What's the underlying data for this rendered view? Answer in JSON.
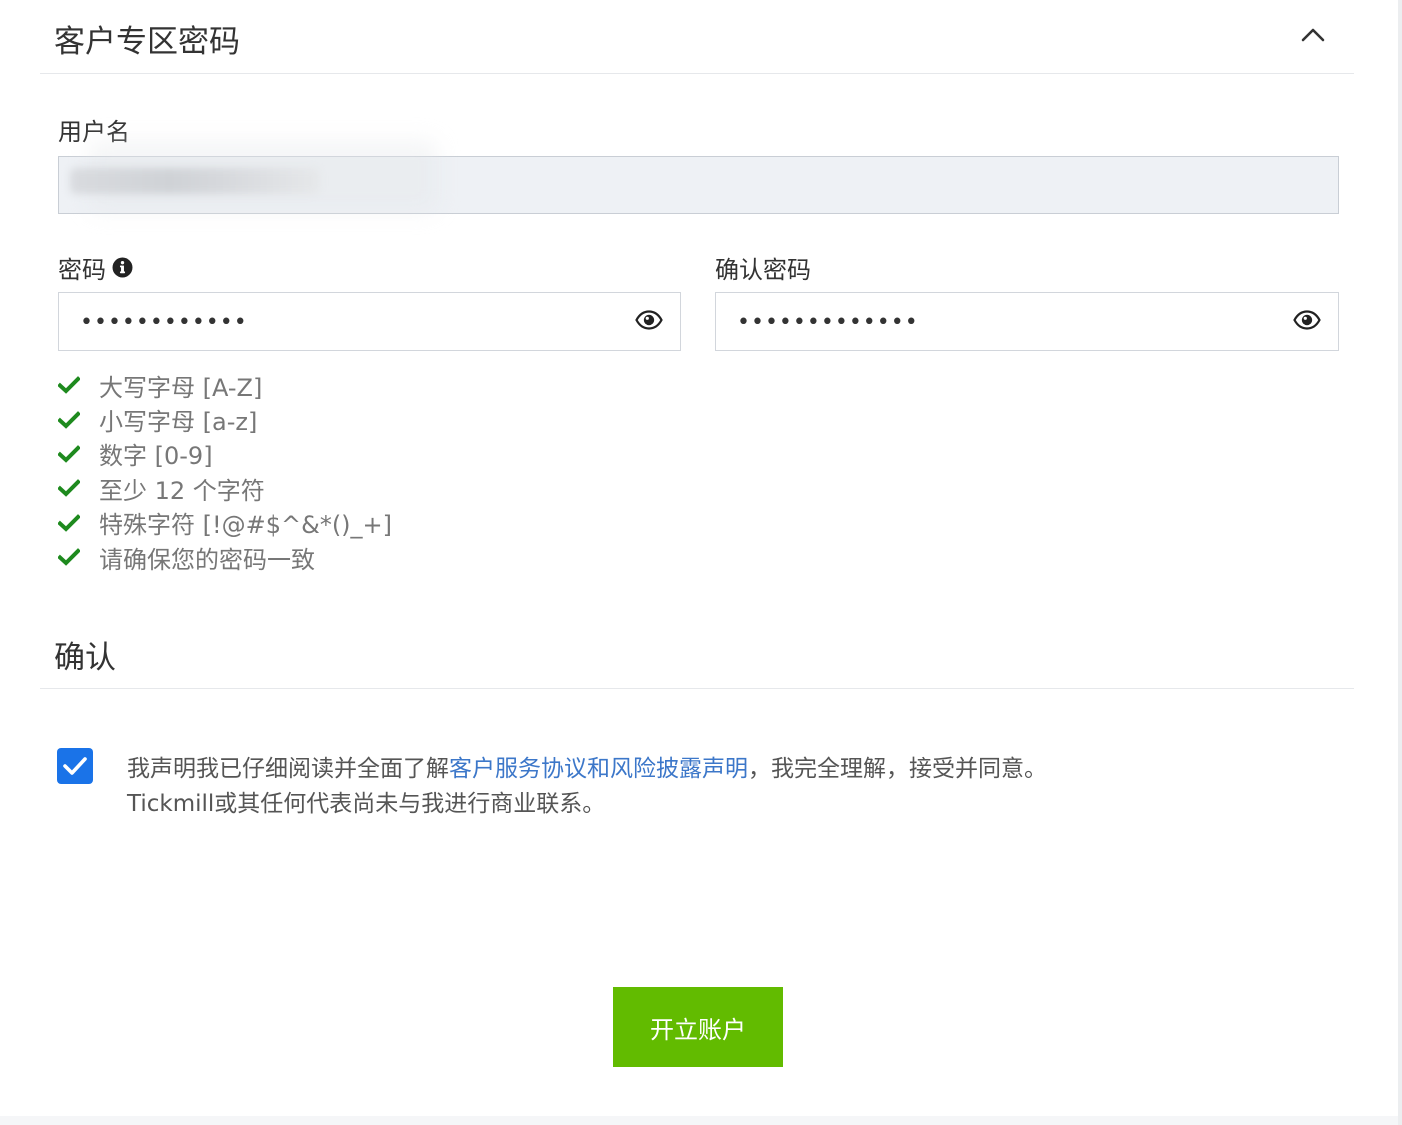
{
  "password_section": {
    "title": "客户专区密码",
    "username_label": "用户名",
    "password_label": "密码",
    "password_value": "••••••••••••",
    "confirm_label": "确认密码",
    "confirm_value": "•••••••••••••",
    "rules": [
      "大写字母 [A-Z]",
      "小写字母 [a-z]",
      "数字 [0-9]",
      "至少 12 个字符",
      "特殊字符 [!@#$^&*()_+]",
      "请确保您的密码一致"
    ],
    "rule_color": "#1e8a1e"
  },
  "confirm_section": {
    "title": "确认",
    "checked": true,
    "text_before": "我声明我已仔细阅读并全面了解",
    "link_text": "客户服务协议和风险披露声明",
    "text_after": "，我完全理解，接受并同意。",
    "text_line2": "Tickmill或其任何代表尚未与我进行商业联系。"
  },
  "submit_label": "开立账户",
  "colors": {
    "accent": "#62bb00",
    "checkbox": "#1a73e8",
    "link": "#3c77c9"
  },
  "icons": [
    "chevron-up-icon",
    "info-icon",
    "eye-icon",
    "check-icon"
  ]
}
